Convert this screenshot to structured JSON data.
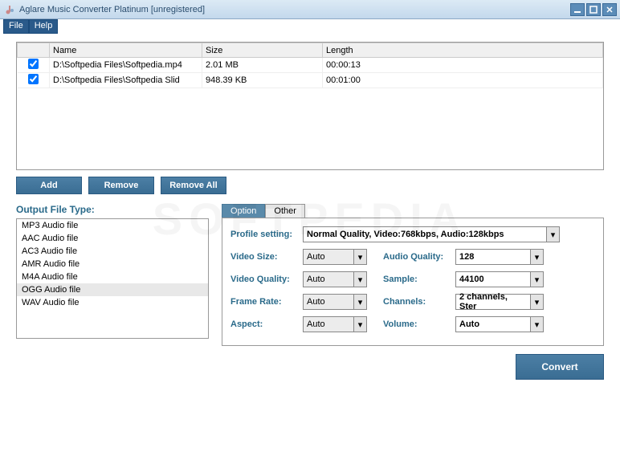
{
  "window": {
    "title": "Aglare Music Converter Platinum  [unregistered]"
  },
  "menu": {
    "file": "File",
    "help": "Help"
  },
  "filetable": {
    "headers": {
      "check": "",
      "name": "Name",
      "size": "Size",
      "length": "Length"
    },
    "rows": [
      {
        "checked": true,
        "name": "D:\\Softpedia Files\\Softpedia.mp4",
        "size": "2.01 MB",
        "length": "00:00:13"
      },
      {
        "checked": true,
        "name": "D:\\Softpedia Files\\Softpedia Slid",
        "size": "948.39 KB",
        "length": "00:01:00"
      }
    ]
  },
  "buttons": {
    "add": "Add",
    "remove": "Remove",
    "removeall": "Remove All",
    "convert": "Convert"
  },
  "outputtype": {
    "label": "Output File Type:",
    "items": [
      "MP3 Audio file",
      "AAC Audio file",
      "AC3 Audio file",
      "AMR Audio file",
      "M4A Audio file",
      "OGG Audio file",
      "WAV Audio file"
    ],
    "selected": "OGG Audio file"
  },
  "tabs": {
    "option": "Option",
    "other": "Other"
  },
  "settings": {
    "profile_label": "Profile setting:",
    "profile_value": "Normal Quality, Video:768kbps, Audio:128kbps",
    "video_size_label": "Video Size:",
    "video_size_value": "Auto",
    "video_quality_label": "Video Quality:",
    "video_quality_value": "Auto",
    "frame_rate_label": "Frame Rate:",
    "frame_rate_value": "Auto",
    "aspect_label": "Aspect:",
    "aspect_value": "Auto",
    "audio_quality_label": "Audio Quality:",
    "audio_quality_value": "128",
    "sample_label": "Sample:",
    "sample_value": "44100",
    "channels_label": "Channels:",
    "channels_value": "2 channels, Ster",
    "volume_label": "Volume:",
    "volume_value": "Auto"
  },
  "watermark": "SOFTPEDIA"
}
